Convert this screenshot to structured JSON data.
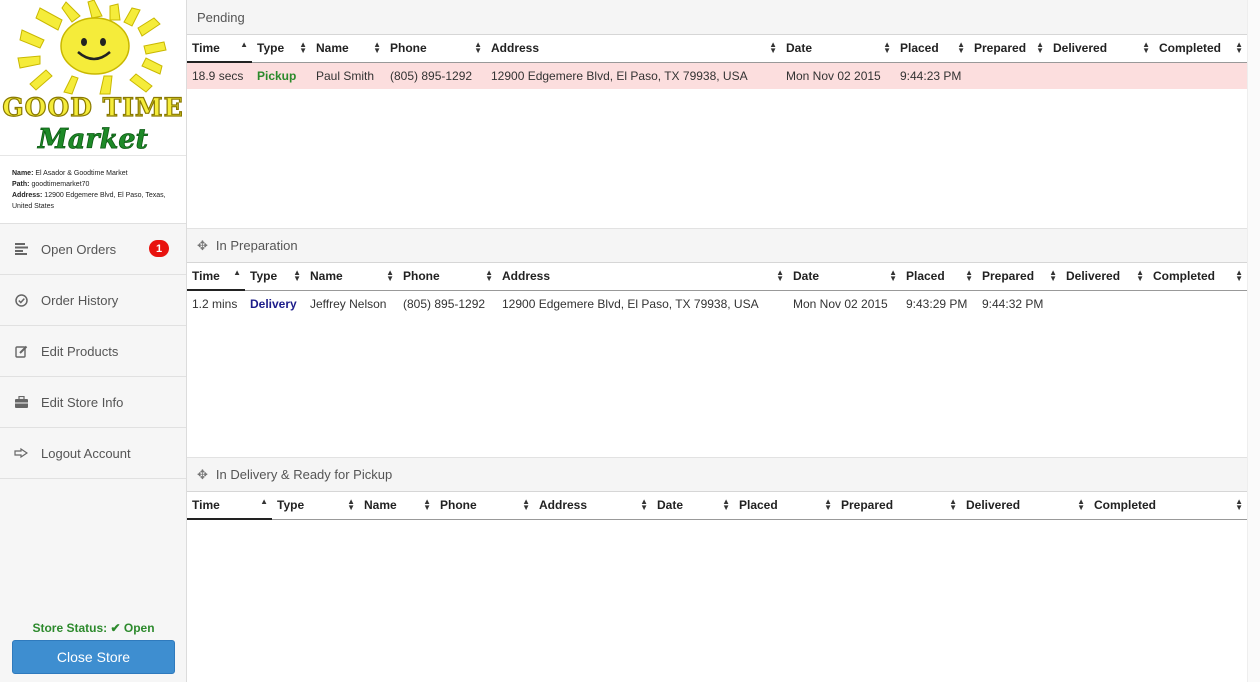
{
  "store": {
    "logo_line1": "GOOD TIME",
    "logo_line2": "Market",
    "name_label": "Name:",
    "name": "El Asador & Goodtime Market",
    "path_label": "Path:",
    "path": "goodtimemarket70",
    "address_label": "Address:",
    "address": "12900 Edgemere Blvd, El Paso, Texas, United States"
  },
  "nav": [
    {
      "label": "Open Orders",
      "icon": "list-icon",
      "badge": "1"
    },
    {
      "label": "Order History",
      "icon": "check-circle-icon"
    },
    {
      "label": "Edit Products",
      "icon": "edit-icon"
    },
    {
      "label": "Edit Store Info",
      "icon": "briefcase-icon"
    },
    {
      "label": "Logout Account",
      "icon": "logout-hand-icon"
    }
  ],
  "status": {
    "label": "Store Status:",
    "check": "✔",
    "value": "Open",
    "color": "#2d8a2d"
  },
  "close_button": "Close Store",
  "panels": {
    "pending": {
      "title": "Pending",
      "headers": [
        "Time",
        "Type",
        "Name",
        "Phone",
        "Address",
        "Date",
        "Placed",
        "Prepared",
        "Delivered",
        "Completed"
      ],
      "rows": [
        {
          "time": "18.9 secs",
          "type": "Pickup",
          "name": "Paul Smith",
          "phone": "(805) 895-1292",
          "address": "12900 Edgemere Blvd, El Paso, TX 79938, USA",
          "date": "Mon Nov 02 2015",
          "placed": "9:44:23 PM",
          "prepared": "",
          "delivered": "",
          "completed": ""
        }
      ]
    },
    "preparation": {
      "title": "In Preparation",
      "headers": [
        "Time",
        "Type",
        "Name",
        "Phone",
        "Address",
        "Date",
        "Placed",
        "Prepared",
        "Delivered",
        "Completed"
      ],
      "rows": [
        {
          "time": "1.2 mins",
          "type": "Delivery",
          "name": "Jeffrey Nelson",
          "phone": "(805) 895-1292",
          "address": "12900 Edgemere Blvd, El Paso, TX 79938, USA",
          "date": "Mon Nov 02 2015",
          "placed": "9:43:29 PM",
          "prepared": "9:44:32 PM",
          "delivered": "",
          "completed": ""
        }
      ]
    },
    "delivery": {
      "title": "In Delivery & Ready for Pickup",
      "headers": [
        "Time",
        "Type",
        "Name",
        "Phone",
        "Address",
        "Date",
        "Placed",
        "Prepared",
        "Delivered",
        "Completed"
      ],
      "rows": []
    }
  },
  "colors": {
    "accent": "#3e8ed0",
    "badge": "#e8130f",
    "pending_row": "#fcdede",
    "pickup": "#2b8a2b",
    "delivery": "#1c1c8a"
  }
}
